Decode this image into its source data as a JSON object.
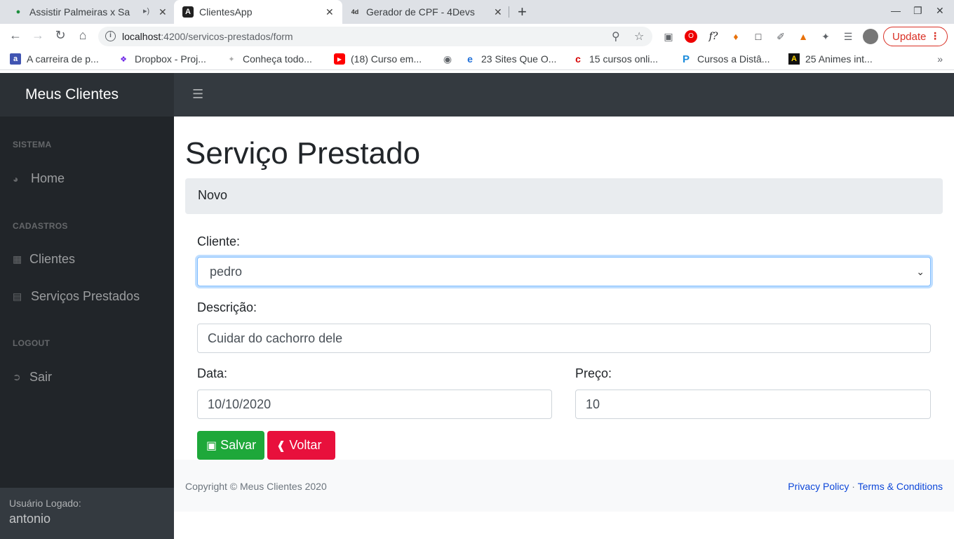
{
  "browser": {
    "tabs": [
      {
        "title": "Assistir Palmeiras x Sa",
        "icon": "shield-icon"
      },
      {
        "title": "ClientesApp",
        "icon": "angular-icon"
      },
      {
        "title": "Gerador de CPF - 4Devs",
        "icon": "4devs-icon"
      }
    ],
    "url_host": "localhost",
    "url_path": ":4200/servicos-prestados/form",
    "update_label": "Update",
    "bookmarks": [
      {
        "label": "A carreira de p..."
      },
      {
        "label": "Dropbox - Proj..."
      },
      {
        "label": "Conheça todo..."
      },
      {
        "label": "(18) Curso em..."
      },
      {
        "label": ""
      },
      {
        "label": "23 Sites Que O..."
      },
      {
        "label": "15 cursos onli..."
      },
      {
        "label": "Cursos a Distâ..."
      },
      {
        "label": "25 Animes int..."
      }
    ]
  },
  "app": {
    "brand": "Meus Clientes",
    "sidebar": {
      "sections": [
        {
          "heading": "SISTEMA",
          "items": [
            {
              "label": "Home",
              "icon": "dashboard-icon"
            }
          ]
        },
        {
          "heading": "CADASTROS",
          "items": [
            {
              "label": "Clientes",
              "icon": "table-icon"
            },
            {
              "label": "Serviços Prestados",
              "icon": "id-card-icon"
            }
          ]
        },
        {
          "heading": "LOGOUT",
          "items": [
            {
              "label": "Sair",
              "icon": "sign-out-icon"
            }
          ]
        }
      ],
      "footer_label": "Usuário Logado:",
      "user": "antonio"
    },
    "page_title": "Serviço Prestado",
    "breadcrumb": "Novo",
    "form": {
      "cliente_label": "Cliente:",
      "cliente_value": "pedro",
      "descricao_label": "Descrição:",
      "descricao_value": "Cuidar do cachorro dele",
      "data_label": "Data:",
      "data_value": "10/10/2020",
      "preco_label": "Preço:",
      "preco_value": "10",
      "save_label": "Salvar",
      "back_label": "Voltar"
    },
    "footer": {
      "copyright": "Copyright © Meus Clientes 2020",
      "privacy": "Privacy Policy",
      "separator": "·",
      "terms": "Terms & Conditions"
    }
  },
  "colors": {
    "save": "#1ea83a",
    "back": "#e8103c",
    "link": "#0d47d9"
  }
}
